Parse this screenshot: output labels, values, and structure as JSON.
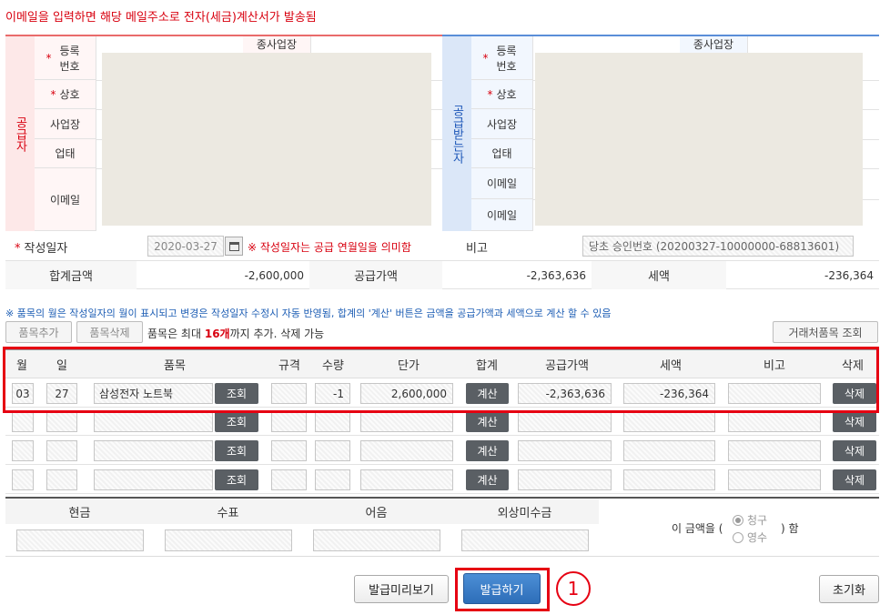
{
  "notice": "이메일을 입력하면 해당 메일주소로 전자(세금)계산서가 발송됨",
  "supplier": {
    "side": "공급자",
    "reg_no": "등록 번호",
    "branch": "종사업장",
    "name": "상호",
    "address": "사업장",
    "biz_type": "업태",
    "email": "이메일"
  },
  "receiver": {
    "side": "공급받는자",
    "reg_no": "등록 번호",
    "branch": "종사업장",
    "name": "상호",
    "address": "사업장",
    "biz_type": "업태",
    "email1": "이메일",
    "email2": "이메일"
  },
  "write_date": {
    "label": "작성일자",
    "value": "2020-03-27",
    "note": "※ 작성일자는 공급 연월일을 의미함"
  },
  "remark": {
    "label": "비고",
    "value": "당초 승인번호 (20200327-10000000-68813601)"
  },
  "totals": {
    "total_label": "합계금액",
    "total_value": "-2,600,000",
    "supply_label": "공급가액",
    "supply_value": "-2,363,636",
    "tax_label": "세액",
    "tax_value": "-236,364"
  },
  "info": "※ 품목의 월은 작성일자의 월이 표시되고 변경은 작성일자 수정시 자동 반영됨, 합계의 '계산' 버튼은 금액을 공급가액과 세액으로 계산 할 수 있음",
  "toolbar": {
    "add": "품목추가",
    "delete": "품목삭제",
    "limit_prefix": "품목은 최대 ",
    "limit_num": "16개",
    "limit_suffix": "까지 추가. 삭제 가능",
    "lookup": "거래처품목 조회"
  },
  "columns": [
    "월",
    "일",
    "품목",
    "규격",
    "수량",
    "단가",
    "합계",
    "공급가액",
    "세액",
    "비고",
    "삭제"
  ],
  "row1": {
    "month": "03",
    "day": "27",
    "item": "삼성전자 노트북",
    "lookup": "조회",
    "qty": "-1",
    "price": "2,600,000",
    "calc": "계산",
    "supply": "-2,363,636",
    "tax": "-236,364",
    "del": "삭제"
  },
  "row_buttons": {
    "lookup": "조회",
    "calc": "계산",
    "del": "삭제"
  },
  "payment": {
    "cash": "현금",
    "check": "수표",
    "note": "어음",
    "credit": "외상미수금",
    "prefix": "이 금액을 (",
    "claim": "청구",
    "receipt": "영수",
    "suffix": ") 함"
  },
  "buttons": {
    "preview": "발급미리보기",
    "issue": "발급하기",
    "reset": "초기화"
  },
  "marker": "1"
}
